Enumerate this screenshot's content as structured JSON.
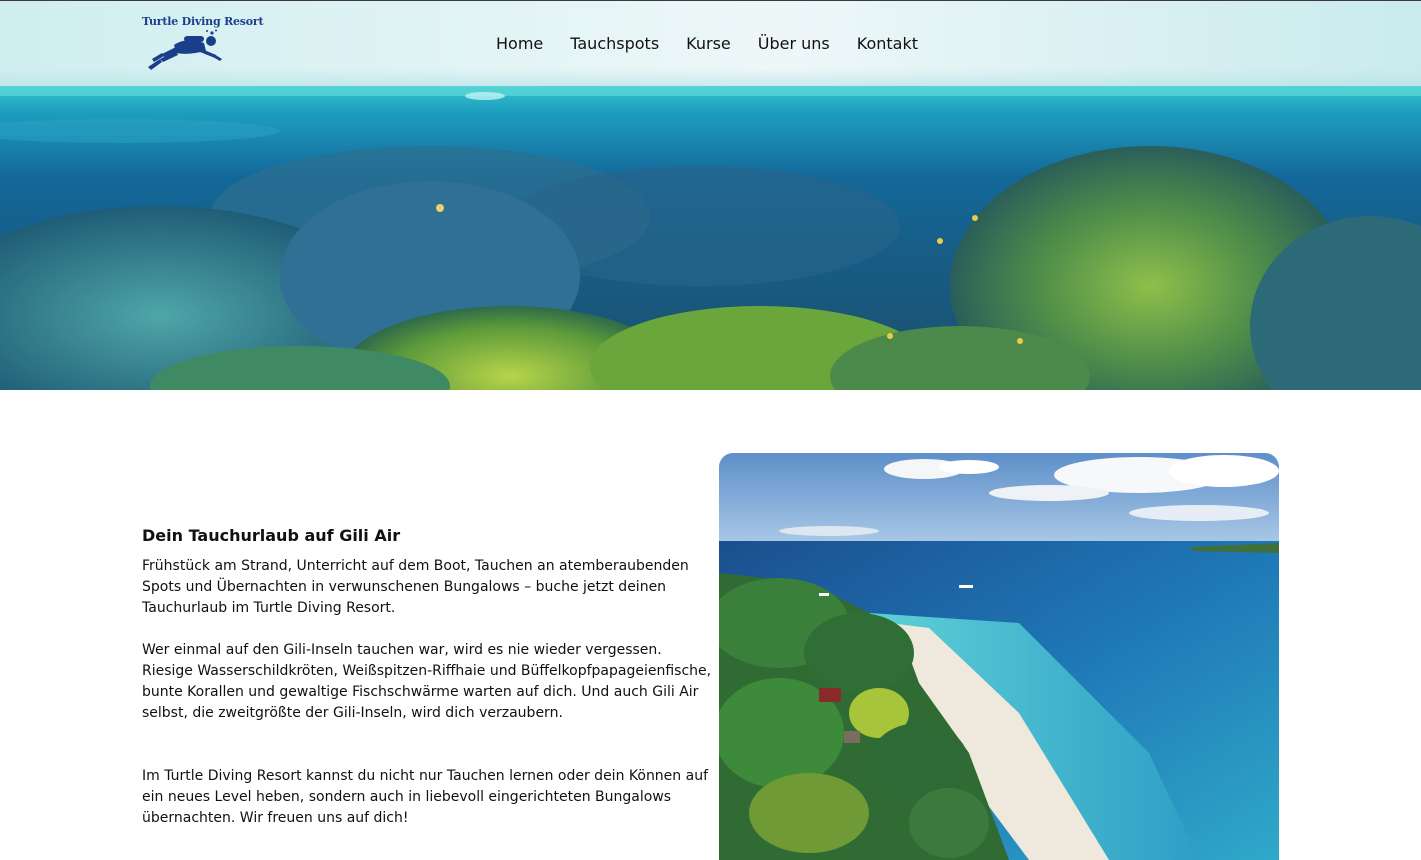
{
  "header": {
    "logo_text": "Turtle Diving Resort",
    "nav": [
      "Home",
      "Tauchspots",
      "Kurse",
      "Über uns",
      "Kontakt"
    ]
  },
  "hero": {
    "image": "coral-reef-underwater-panorama"
  },
  "intro": {
    "title": "Dein Tauchurlaub auf Gili Air",
    "paragraphs": [
      "Frühstück am Strand, Unterricht auf dem Boot, Tauchen an atemberaubenden Spots und Übernachten in verwunschenen Bungalows – buche jetzt deinen Tauchurlaub im Turtle Diving Resort.",
      "Wer einmal auf den Gili-Inseln tauchen war, wird es nie wieder vergessen. Riesige Wasserschildkröten, Weißspitzen-Riffhaie und Büffelkopfpapageienfische, bunte Korallen und gewaltige Fischschwärme warten auf dich. Und auch Gili Air selbst, die zweitgrößte der Gili-Inseln, wird dich verzaubern.",
      "Im Turtle Diving Resort kannst du nicht nur Tauchen lernen oder dein Können auf ein neues Level heben, sondern auch in liebevoll eingerichteten Bungalows übernachten. Wir freuen uns auf dich!"
    ],
    "image": "gili-air-aerial-beach-photo"
  },
  "colors": {
    "logo": "#1a3f8a",
    "text": "#111111",
    "sea": "#1f7fb5",
    "sand": "#efe9dd"
  }
}
